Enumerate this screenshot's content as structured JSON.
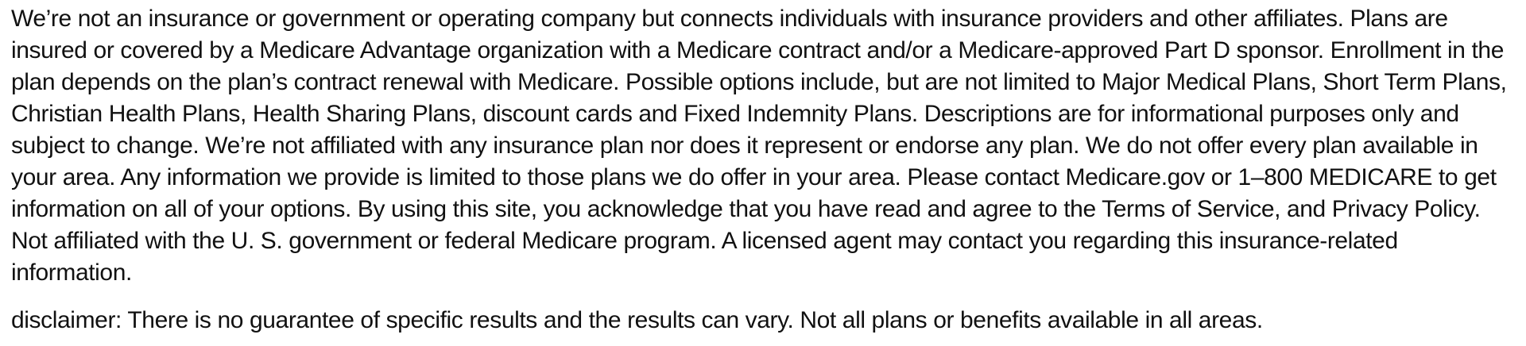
{
  "main": {
    "paragraph": "We’re not an insurance or government or operating company but connects individuals with insurance providers and other affiliates. Plans are insured or covered by a Medicare Advantage organization with a Medicare contract and/or a Medicare-approved Part D sponsor. Enrollment in the plan depends on the plan’s contract renewal with Medicare. Possible options include, but are not limited to Major Medical Plans, Short Term Plans, Christian Health Plans, Health Sharing Plans, discount cards and Fixed Indemnity Plans. Descriptions are for informational purposes only and subject to change. We’re not affiliated with any insurance plan nor does it represent or endorse any plan. We do not offer every plan available in your area. Any information we provide is limited to those plans we do offer in your area. Please contact Medicare.gov or 1–800 MEDICARE to get information on all of your options. By using this site, you acknowledge that you have read and agree to the Terms of Service, and Privacy Policy. Not affiliated with the U. S. government or federal Medicare program. A licensed agent may contact you regarding this insurance-related information.",
    "disclaimer": "disclaimer: There is no guarantee of specific results and the results can vary. Not all plans or benefits available in all areas."
  }
}
